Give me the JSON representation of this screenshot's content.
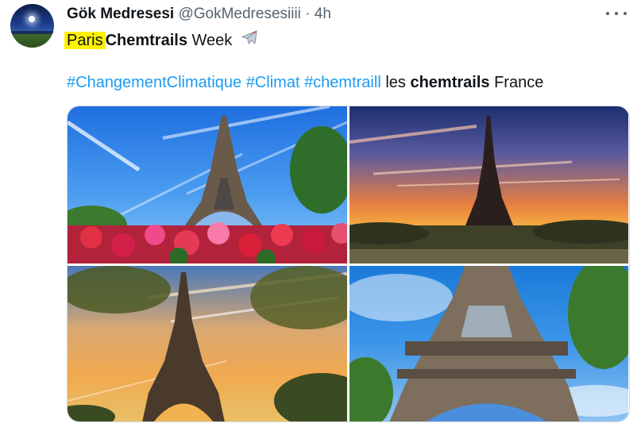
{
  "tweet": {
    "display_name": "Gök Medresesi",
    "handle": "@GokMedresesiiii",
    "separator": "·",
    "time": "4h",
    "line1": {
      "highlighted": "Paris",
      "bold": "Chemtrails",
      "rest": "Week",
      "emoji": "airplane-icon"
    },
    "line2": {
      "hashtags": [
        "#ChangementClimatique",
        "#Climat",
        "#chemtraill"
      ],
      "word_les": "les",
      "bold": "chemtrails",
      "tail": "France"
    },
    "colors": {
      "link": "#1d9bf0",
      "highlight": "#fff200",
      "muted": "#536471",
      "text": "#0f1419"
    }
  },
  "media": {
    "count": 4,
    "photos": [
      {
        "subject": "Eiffel Tower, blue sky with red and pink flowers"
      },
      {
        "subject": "Eiffel Tower at sunset over Paris skyline"
      },
      {
        "subject": "Eiffel Tower with golden sky and trees"
      },
      {
        "subject": "Eiffel Tower from below with blue sky"
      }
    ]
  }
}
